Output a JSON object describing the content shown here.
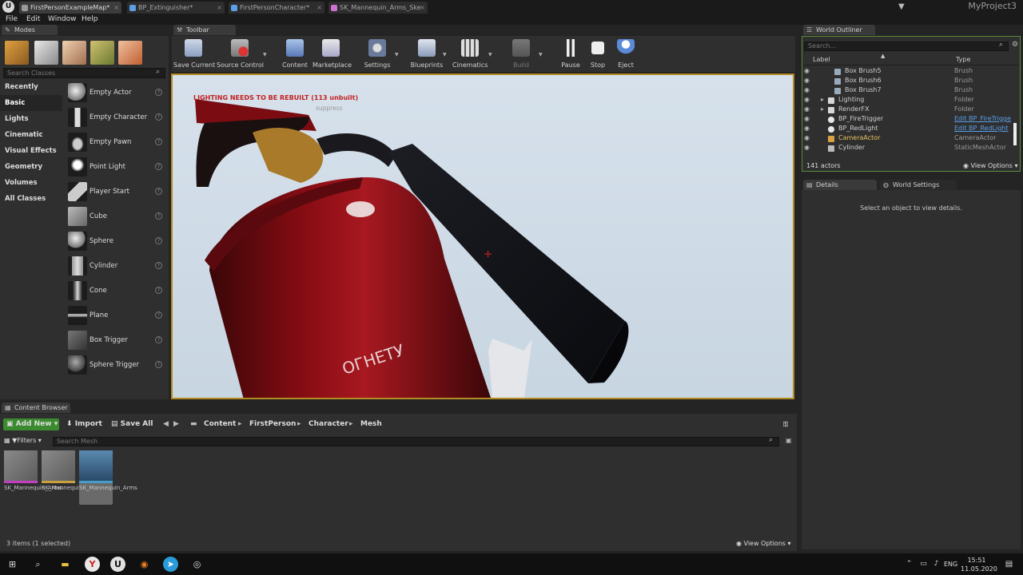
{
  "window": {
    "project": "MyProject3"
  },
  "doc_tabs": [
    {
      "label": "FirstPersonExampleMap*",
      "color": "#9a9a9a"
    },
    {
      "label": "BP_Extinguisher*",
      "color": "#5aa0e8"
    },
    {
      "label": "FirstPersonCharacter*",
      "color": "#5aa0e8"
    },
    {
      "label": "SK_Mannequin_Arms_Ske",
      "color": "#d070d0"
    }
  ],
  "menu": [
    "File",
    "Edit",
    "Window",
    "Help"
  ],
  "modes": {
    "tab_label": "Modes",
    "search_placeholder": "Search Classes",
    "categories": [
      "Recently Placed",
      "Basic",
      "Lights",
      "Cinematic",
      "Visual Effects",
      "Geometry",
      "Volumes",
      "All Classes"
    ],
    "selected_category": "Basic",
    "items": [
      "Empty Actor",
      "Empty Character",
      "Empty Pawn",
      "Point Light",
      "Player Start",
      "Cube",
      "Sphere",
      "Cylinder",
      "Cone",
      "Plane",
      "Box Trigger",
      "Sphere Trigger"
    ]
  },
  "toolbar": {
    "tab_label": "Toolbar",
    "buttons": [
      {
        "label": "Save Current",
        "icon": "save-icon"
      },
      {
        "label": "Source Control",
        "icon": "source-control-icon"
      },
      {
        "label": "Content",
        "icon": "content-icon"
      },
      {
        "label": "Marketplace",
        "icon": "marketplace-icon"
      },
      {
        "label": "Settings",
        "icon": "settings-icon"
      },
      {
        "label": "Blueprints",
        "icon": "blueprints-icon"
      },
      {
        "label": "Cinematics",
        "icon": "cinematics-icon"
      },
      {
        "label": "Build",
        "icon": "build-icon"
      },
      {
        "label": "Pause",
        "icon": "pause-icon"
      },
      {
        "label": "Stop",
        "icon": "stop-icon"
      },
      {
        "label": "Eject",
        "icon": "eject-icon"
      }
    ]
  },
  "viewport": {
    "warning": "LIGHTING NEEDS TO BE REBUILT (113 unbuilt)",
    "suppress": "suppress",
    "decal_text": "ОГНЕТУ"
  },
  "outliner": {
    "tab_label": "World Outliner",
    "search_placeholder": "Search...",
    "col_label": "Label",
    "col_type": "Type",
    "rows": [
      {
        "name": "Box Brush5",
        "type": "Brush",
        "indent": 1,
        "link": false
      },
      {
        "name": "Box Brush6",
        "type": "Brush",
        "indent": 1,
        "link": false
      },
      {
        "name": "Box Brush7",
        "type": "Brush",
        "indent": 1,
        "link": false
      },
      {
        "name": "Lighting",
        "type": "Folder",
        "indent": 0,
        "link": false
      },
      {
        "name": "RenderFX",
        "type": "Folder",
        "indent": 0,
        "link": false
      },
      {
        "name": "BP_FireTrigger",
        "type": "Edit BP_FireTrigge",
        "indent": 0,
        "link": true
      },
      {
        "name": "BP_RedLight",
        "type": "Edit BP_RedLight",
        "indent": 0,
        "link": true
      },
      {
        "name": "CameraActor",
        "type": "CameraActor",
        "indent": 0,
        "link": false
      },
      {
        "name": "Cylinder",
        "type": "StaticMeshActor",
        "indent": 0,
        "link": false
      }
    ],
    "count": "141 actors",
    "view_options": "View Options"
  },
  "details": {
    "tab_label": "Details",
    "tab2_label": "World Settings",
    "empty_text": "Select an object to view details."
  },
  "content_browser": {
    "tab_label": "Content Browser",
    "add_new": "Add New",
    "import": "Import",
    "save_all": "Save All",
    "crumbs": [
      "Content",
      "FirstPerson",
      "Character",
      "Mesh"
    ],
    "filters": "Filters",
    "search_placeholder": "Search Mesh",
    "assets": [
      {
        "name": "SK_Mannequin_Arms",
        "bar": "#c040c0"
      },
      {
        "name": "SK_Mannequin_Arms",
        "bar": "#c8a040"
      },
      {
        "name": "SK_Mannequin_Arms",
        "bar": "#4a9cc8"
      }
    ],
    "status": "3 items (1 selected)",
    "view_options": "View Options"
  },
  "taskbar": {
    "lang": "ENG",
    "time": "15:51",
    "date": "11.05.2020"
  }
}
